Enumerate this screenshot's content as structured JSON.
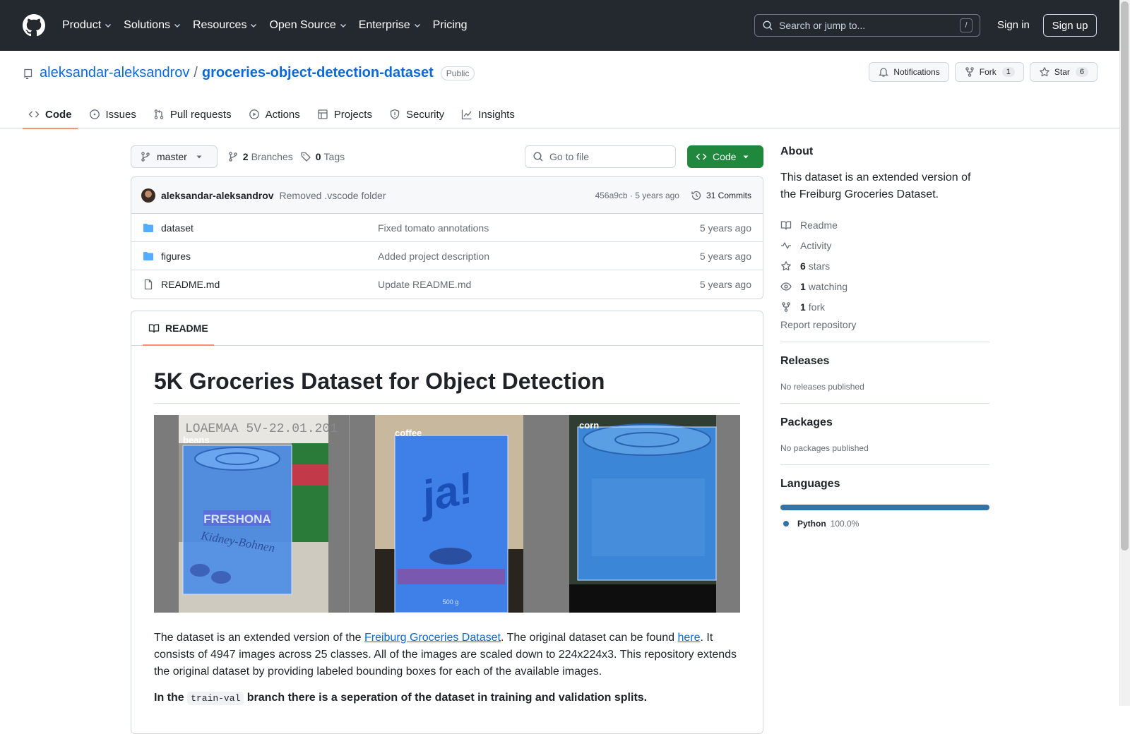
{
  "header": {
    "nav": [
      "Product",
      "Solutions",
      "Resources",
      "Open Source",
      "Enterprise",
      "Pricing"
    ],
    "search_placeholder": "Search or jump to...",
    "search_shortcut": "/",
    "sign_in": "Sign in",
    "sign_up": "Sign up"
  },
  "repo": {
    "owner": "aleksandar-aleksandrov",
    "separator": "/",
    "name": "groceries-object-detection-dataset",
    "visibility": "Public",
    "notifications_label": "Notifications",
    "fork_label": "Fork",
    "fork_count": "1",
    "star_label": "Star",
    "star_count": "6",
    "tabs": [
      "Code",
      "Issues",
      "Pull requests",
      "Actions",
      "Projects",
      "Security",
      "Insights"
    ]
  },
  "toolbar": {
    "branch": "master",
    "branches_count": "2",
    "branches_label": "Branches",
    "tags_count": "0",
    "tags_label": "Tags",
    "go_to_file": "Go to file",
    "code_button": "Code"
  },
  "commit": {
    "author": "aleksandar-aleksandrov",
    "message": "Removed .vscode folder",
    "sha_time": "456a9cb · 5 years ago",
    "commits": "31 Commits"
  },
  "files": [
    {
      "name": "dataset",
      "message": "Fixed tomato annotations",
      "date": "5 years ago",
      "type": "dir"
    },
    {
      "name": "figures",
      "message": "Added project description",
      "date": "5 years ago",
      "type": "dir"
    },
    {
      "name": "README.md",
      "message": "Update README.md",
      "date": "5 years ago",
      "type": "file"
    }
  ],
  "readme": {
    "tab": "README",
    "title": "5K Groceries Dataset for Object Detection",
    "figure_labels": [
      "beans",
      "coffee",
      "corn"
    ],
    "can_texts": [
      "FRESHONA",
      "Kidney-Bohnen",
      "ja!",
      "LOAEMAA 5V-22.01.201",
      "500 g"
    ],
    "p1_a": "The dataset is an extended version of the ",
    "p1_link1": "Freiburg Groceries Dataset",
    "p1_b": ". The original dataset can be found ",
    "p1_link2": "here",
    "p1_c": ". It consists of 4947 images across 25 classes. All of the images are scaled down to 224x224x3. This repository extends the original dataset by providing labeled bounding boxes for each of the available images.",
    "p2_a": "In the ",
    "p2_code": "train-val",
    "p2_b": " branch there is a seperation of the dataset in training and validation splits."
  },
  "sidebar": {
    "about_title": "About",
    "description": "This dataset is an extended version of the Freiburg Groceries Dataset.",
    "readme": "Readme",
    "activity": "Activity",
    "stars_count": "6",
    "stars_label": "stars",
    "watching_count": "1",
    "watching_label": "watching",
    "forks_count": "1",
    "forks_label": "fork",
    "report": "Report repository",
    "releases_title": "Releases",
    "releases_none": "No releases published",
    "packages_title": "Packages",
    "packages_none": "No packages published",
    "languages_title": "Languages",
    "language": "Python",
    "language_pct": "100.0%",
    "language_share": 1.0,
    "language_color": "#3572A5"
  },
  "colors": {
    "header_bg": "#24292f",
    "link": "#0969da",
    "code_button": "#1f883d",
    "active_tab_underline": "#fd8c73"
  }
}
